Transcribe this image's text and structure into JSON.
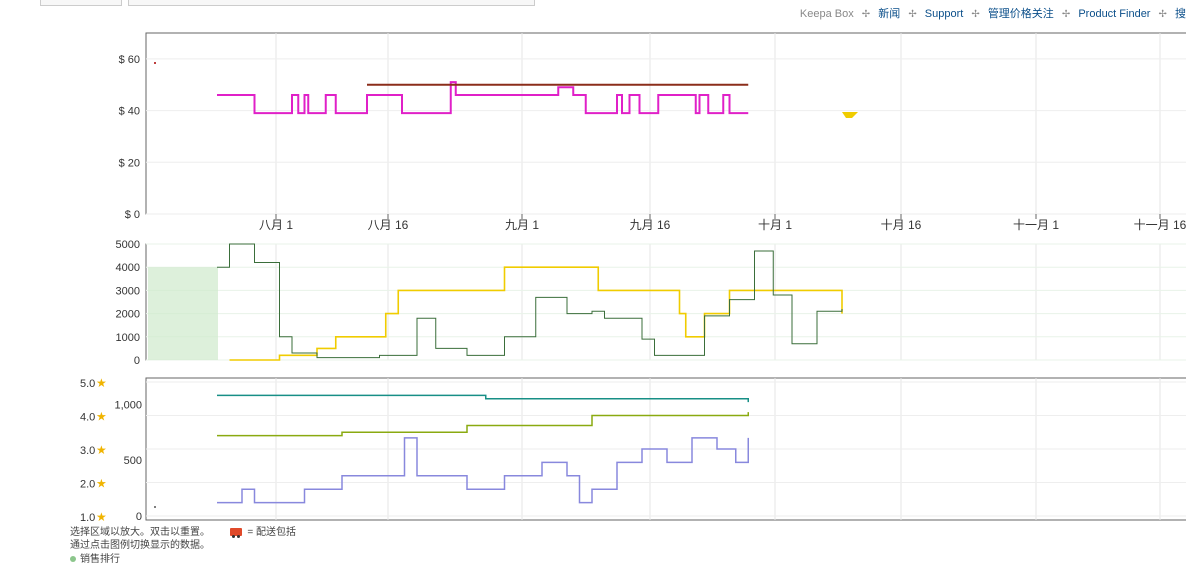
{
  "nav": {
    "brand": "Keepa Box",
    "links": [
      "新闻",
      "Support",
      "管理价格关注",
      "Product Finder",
      "搜"
    ]
  },
  "footer": {
    "hint1": "选择区域以放大。双击以重置。",
    "hint2": "通过点击图例切换显示的数据。",
    "shipping_legend": "= 配送包括",
    "legend_item": "销售排行"
  },
  "colors": {
    "amazon_price": "#e020c8",
    "new_price": "#8b2d1a",
    "sales_rank": "#3a6e3a",
    "sales_rank_fill": "#cfeacc",
    "yellow_series": "#f0cc00",
    "rating": "#8aaa10",
    "teal_series": "#178f86",
    "review_count": "#8888dd"
  },
  "chart_data": [
    {
      "type": "line",
      "panel": "price",
      "x_ticks": [
        "八月 1",
        "八月 16",
        "九月 1",
        "九月 16",
        "十月 1",
        "十月 16",
        "十一月 1",
        "十一月 16"
      ],
      "y_ticks": [
        "$ 0",
        "$ 20",
        "$ 40",
        "$ 60"
      ],
      "ylim": [
        0,
        70
      ],
      "series": [
        {
          "name": "",
          "color_key": "amazon_price",
          "steps": [
            [
              0,
              46
            ],
            [
              0.3,
              39
            ],
            [
              0.6,
              46
            ],
            [
              0.65,
              39
            ],
            [
              0.7,
              46
            ],
            [
              0.73,
              39
            ],
            [
              0.87,
              46
            ],
            [
              0.95,
              39
            ],
            [
              1.2,
              46
            ],
            [
              1.48,
              39
            ],
            [
              1.87,
              51
            ],
            [
              1.91,
              46
            ],
            [
              2.73,
              49
            ],
            [
              2.85,
              46
            ],
            [
              2.95,
              39
            ],
            [
              3.2,
              46
            ],
            [
              3.24,
              39
            ],
            [
              3.3,
              46
            ],
            [
              3.38,
              39
            ],
            [
              3.53,
              46
            ],
            [
              3.83,
              39
            ],
            [
              3.86,
              46
            ],
            [
              3.93,
              39
            ],
            [
              4.05,
              46
            ],
            [
              4.1,
              39
            ],
            [
              4.25,
              39
            ]
          ]
        },
        {
          "name": "",
          "color_key": "new_price",
          "steps": [
            [
              1.2,
              50
            ],
            [
              2.8,
              50
            ],
            [
              2.8,
              50
            ],
            [
              4.25,
              50
            ]
          ]
        }
      ]
    },
    {
      "type": "line",
      "panel": "rank",
      "y_ticks": [
        "0",
        "1000",
        "2000",
        "3000",
        "4000",
        "5000"
      ],
      "ylim": [
        0,
        5000
      ],
      "series": [
        {
          "name": "",
          "color_key": "yellow_series",
          "steps": [
            [
              0.1,
              0
            ],
            [
              0.5,
              200
            ],
            [
              0.8,
              500
            ],
            [
              0.95,
              1000
            ],
            [
              1.2,
              1000
            ],
            [
              1.35,
              2000
            ],
            [
              1.45,
              3000
            ],
            [
              2.2,
              3000
            ],
            [
              2.3,
              4000
            ],
            [
              3.0,
              4000
            ],
            [
              3.05,
              3000
            ],
            [
              3.5,
              3000
            ],
            [
              3.7,
              2000
            ],
            [
              3.75,
              1000
            ],
            [
              3.9,
              2000
            ],
            [
              4.1,
              3000
            ],
            [
              4.9,
              3000
            ],
            [
              5.0,
              2000
            ]
          ]
        },
        {
          "name": "",
          "color_key": "sales_rank",
          "steps": [
            [
              0,
              4000
            ],
            [
              0.1,
              5000
            ],
            [
              0.3,
              4200
            ],
            [
              0.5,
              1000
            ],
            [
              0.6,
              300
            ],
            [
              0.8,
              100
            ],
            [
              1.0,
              100
            ],
            [
              1.3,
              200
            ],
            [
              1.6,
              1800
            ],
            [
              1.75,
              500
            ],
            [
              2.0,
              200
            ],
            [
              2.3,
              1000
            ],
            [
              2.55,
              2700
            ],
            [
              2.8,
              2000
            ],
            [
              3.0,
              2100
            ],
            [
              3.1,
              1800
            ],
            [
              3.4,
              900
            ],
            [
              3.5,
              200
            ],
            [
              3.7,
              200
            ],
            [
              3.9,
              1900
            ],
            [
              4.1,
              2600
            ],
            [
              4.3,
              4700
            ],
            [
              4.45,
              2800
            ],
            [
              4.6,
              700
            ],
            [
              4.8,
              2100
            ],
            [
              5.0,
              2200
            ]
          ]
        }
      ]
    },
    {
      "type": "line",
      "panel": "rating_reviews",
      "y_ticks_left": [
        "1.0",
        "2.0",
        "3.0",
        "4.0",
        "5.0"
      ],
      "y_ticks_right": [
        "0",
        "500",
        "1,000"
      ],
      "ylim_rating": [
        1.0,
        5.0
      ],
      "ylim_reviews": [
        0,
        1200
      ],
      "series": [
        {
          "name": "",
          "color_key": "teal_series",
          "axis": "reviews",
          "steps": [
            [
              0,
              1080
            ],
            [
              2.1,
              1080
            ],
            [
              2.15,
              1050
            ],
            [
              3.0,
              1050
            ],
            [
              4.25,
              1020
            ]
          ]
        },
        {
          "name": "",
          "color_key": "rating",
          "axis": "rating",
          "steps": [
            [
              0,
              3.4
            ],
            [
              1.0,
              3.5
            ],
            [
              2.0,
              3.7
            ],
            [
              3.0,
              4.0
            ],
            [
              4.25,
              4.1
            ]
          ]
        },
        {
          "name": "",
          "color_key": "review_count",
          "axis": "reviews",
          "steps": [
            [
              0,
              120
            ],
            [
              0.2,
              240
            ],
            [
              0.3,
              120
            ],
            [
              0.7,
              240
            ],
            [
              1.0,
              360
            ],
            [
              1.3,
              360
            ],
            [
              1.5,
              700
            ],
            [
              1.6,
              360
            ],
            [
              2.0,
              240
            ],
            [
              2.3,
              360
            ],
            [
              2.6,
              480
            ],
            [
              2.8,
              360
            ],
            [
              2.9,
              120
            ],
            [
              3.0,
              240
            ],
            [
              3.2,
              480
            ],
            [
              3.4,
              600
            ],
            [
              3.6,
              480
            ],
            [
              3.8,
              700
            ],
            [
              4.0,
              600
            ],
            [
              4.15,
              480
            ],
            [
              4.25,
              700
            ]
          ]
        }
      ]
    }
  ]
}
